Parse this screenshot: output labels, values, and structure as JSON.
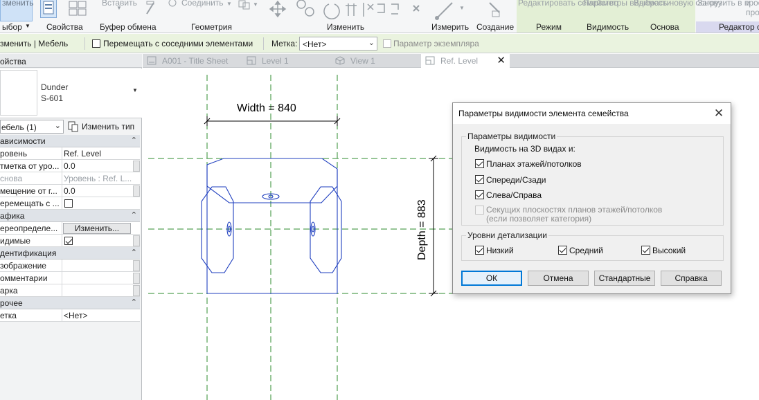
{
  "ribbon": {
    "ghost_labels": {
      "modify_top": "зменить",
      "paste": "Вставить",
      "join": "Соединить",
      "edit_family": "Редактировать семейство",
      "visibility_settings": "Параметры видимости",
      "pick_new_host": "Выбрать новую основу",
      "load_into_project": "Загрузить в проект",
      "cut_prefix": "про"
    },
    "groups": {
      "select": "ыбор",
      "properties": "Свойства",
      "clipboard": "Буфер обмена",
      "geometry": "Геометрия",
      "modify": "Изменить",
      "measure": "Измерить",
      "create": "Создание",
      "mode": "Режим",
      "visibility": "Видимость",
      "host": "Основа",
      "editor": "Редактор с"
    }
  },
  "options_bar": {
    "context": "зменить | Мебель",
    "move_with_nearby": "Перемещать с соседними элементами",
    "tag_label": "Метка:",
    "tag_value": "<Нет>",
    "instance_param": "Параметр экземпляра"
  },
  "properties": {
    "title": "ойства",
    "type_name": "Dunder",
    "type_subname": "S-601",
    "instance_filter": "ебель (1)",
    "edit_type": "Изменить тип",
    "groups": [
      {
        "label": "ависимости"
      },
      {
        "label": "афика"
      },
      {
        "label": "дентификация"
      },
      {
        "label": "рочее"
      }
    ],
    "rows": {
      "level_k": "ровень",
      "level_v": "Ref. Level",
      "elev_k": "тметка от уро...",
      "elev_v": "0.0",
      "host_k": "снова",
      "host_v": "Уровень : Ref. L...",
      "offset_k": "мещение от г...",
      "offset_v": "0.0",
      "move_k": "еремещать с ...",
      "override_k": "ереопределе...",
      "override_v": "Изменить...",
      "visible_k": "идимые",
      "image_k": "зображение",
      "comments_k": "омментарии",
      "mark_k": "арка",
      "tag_k": "етка",
      "tag_v": "<Нет>"
    }
  },
  "tabs": [
    {
      "label": "A001 - Title Sheet"
    },
    {
      "label": "Level 1"
    },
    {
      "label": "View 1"
    },
    {
      "label": "Ref. Level"
    }
  ],
  "drawing": {
    "width_dim": "Width = 840",
    "depth_dim": "Depth = 883"
  },
  "dialog": {
    "title": "Параметры видимости элемента семейства",
    "vis_group": "Параметры видимости",
    "vis_3d": "Видимость на 3D видах и:",
    "plans": "Планах этажей/потолков",
    "front_back": "Спереди/Сзади",
    "left_right": "Слева/Справа",
    "cut_line1": "Секущих плоскостях планов этажей/потолков",
    "cut_line2": "(если позволяет категория)",
    "detail_group": "Уровни детализации",
    "coarse": "Низкий",
    "medium": "Средний",
    "fine": "Высокий",
    "ok": "ОК",
    "cancel": "Отмена",
    "defaults": "Стандартные",
    "help": "Справка"
  },
  "colors": {
    "accent_mode": "#e3efd5",
    "editor_tab": "#d9d9ef",
    "model_lines": "#1f3fbf",
    "ref_planes": "#2e8b2e",
    "default_button_border": "#0078d7"
  }
}
